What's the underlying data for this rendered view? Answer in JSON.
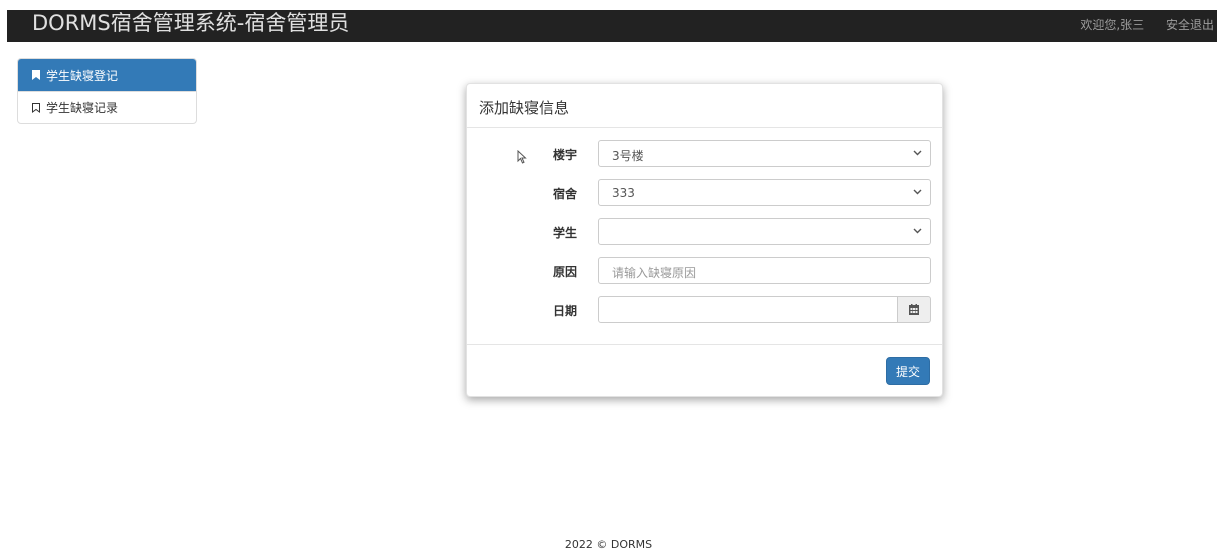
{
  "header": {
    "brand": "DORMS宿舍管理系统-宿舍管理员",
    "welcome": "欢迎您,张三",
    "logout": "安全退出"
  },
  "sidebar": {
    "items": [
      {
        "label": "学生缺寝登记",
        "icon": "bookmark-filled-icon",
        "active": true
      },
      {
        "label": "学生缺寝记录",
        "icon": "bookmark-outline-icon",
        "active": false
      }
    ]
  },
  "panel": {
    "title": "添加缺寝信息",
    "fields": {
      "building": {
        "label": "楼宇",
        "value": "3号楼"
      },
      "dorm": {
        "label": "宿舍",
        "value": "333"
      },
      "student": {
        "label": "学生",
        "value": ""
      },
      "reason": {
        "label": "原因",
        "placeholder": "请输入缺寝原因",
        "value": ""
      },
      "date": {
        "label": "日期",
        "value": "",
        "icon": "calendar-icon"
      }
    },
    "submit_label": "提交"
  },
  "footer": {
    "text": "2022 © DORMS"
  },
  "colors": {
    "navbar": "#222222",
    "primary": "#337ab7"
  }
}
